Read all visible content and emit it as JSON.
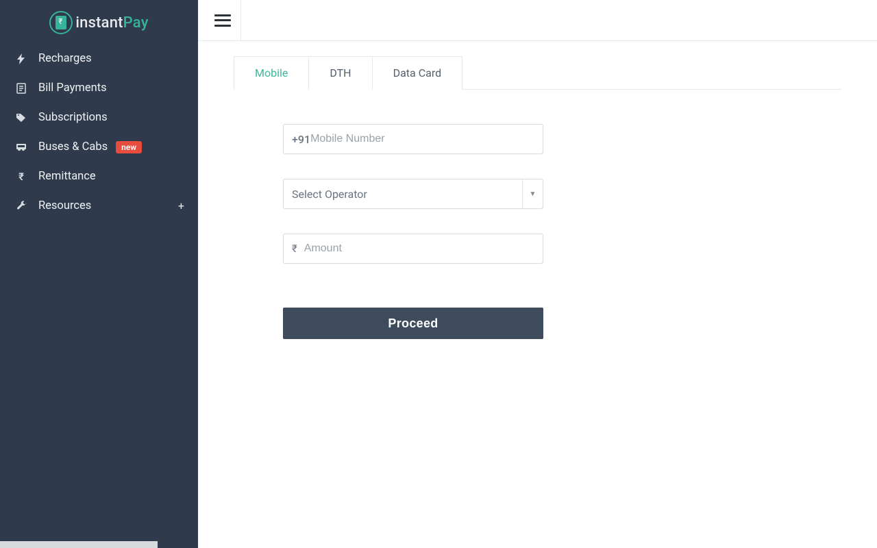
{
  "brand": {
    "name_a": "instant",
    "name_b": "Pay"
  },
  "sidebar": {
    "items": [
      {
        "label": "Recharges"
      },
      {
        "label": "Bill Payments"
      },
      {
        "label": "Subscriptions"
      },
      {
        "label": "Buses & Cabs",
        "badge": "new"
      },
      {
        "label": "Remittance"
      },
      {
        "label": "Resources",
        "expandable": true
      }
    ]
  },
  "tabs": [
    {
      "label": "Mobile",
      "active": true
    },
    {
      "label": "DTH"
    },
    {
      "label": "Data Card"
    }
  ],
  "form": {
    "country_code": "+91",
    "mobile_placeholder": "Mobile Number",
    "operator_placeholder": "Select Operator",
    "currency_symbol": "₹",
    "amount_placeholder": "Amount",
    "submit_label": "Proceed"
  }
}
